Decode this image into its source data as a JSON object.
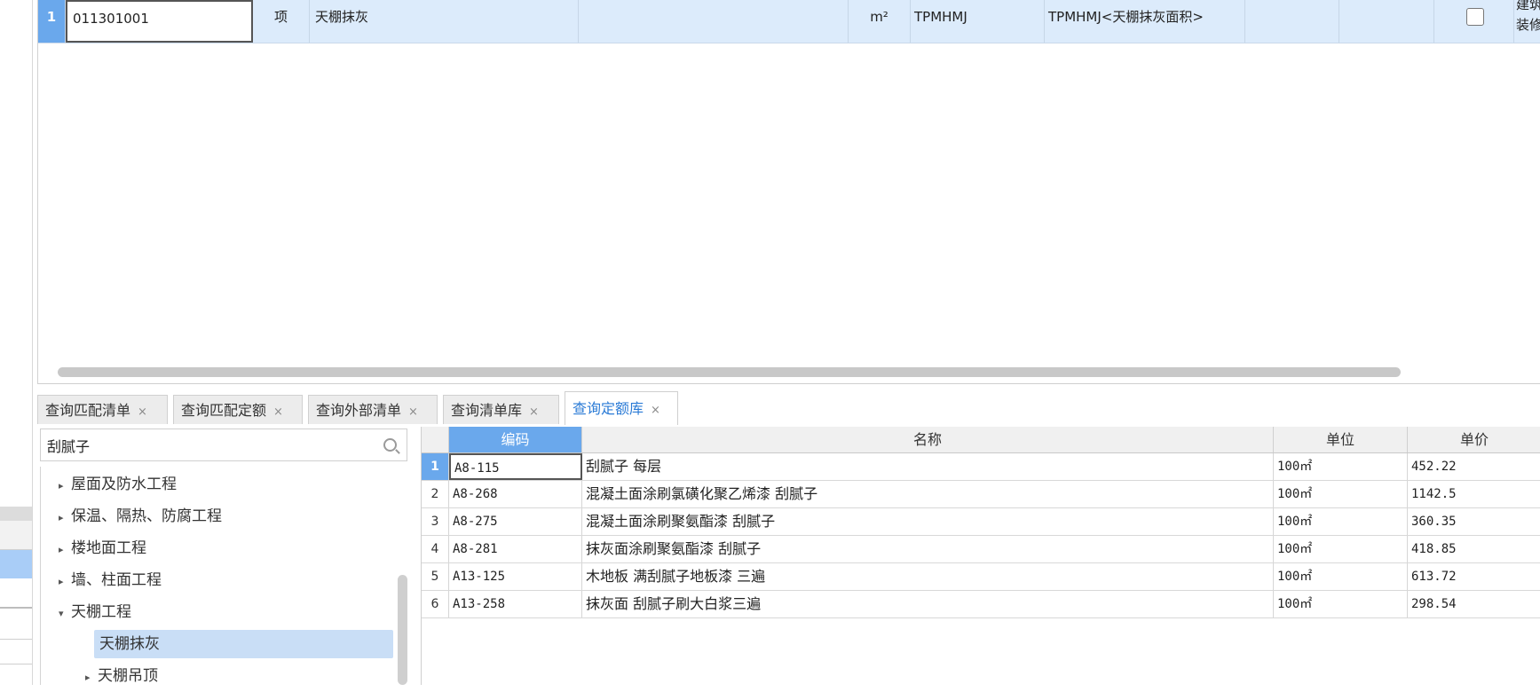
{
  "top_row": {
    "row_number": "1",
    "code": "011301001",
    "type": "项",
    "name": "天棚抹灰",
    "feature": "",
    "unit": "m²",
    "expression": "TPMHMJ",
    "expression_desc": "TPMHMJ<天棚抹灰面积>",
    "empty1": "",
    "empty2": "",
    "category_line1": "建筑装饰",
    "category_line2": "装修工程"
  },
  "tabs": [
    {
      "label": "查询匹配清单",
      "active": false
    },
    {
      "label": "查询匹配定额",
      "active": false
    },
    {
      "label": "查询外部清单",
      "active": false
    },
    {
      "label": "查询清单库",
      "active": false
    },
    {
      "label": "查询定额库",
      "active": true
    }
  ],
  "tab_close_glyph": "×",
  "search": {
    "value": "刮腻子"
  },
  "tree": {
    "items": [
      {
        "label": "屋面及防水工程",
        "arrow": "▸"
      },
      {
        "label": "保温、隔热、防腐工程",
        "arrow": "▸"
      },
      {
        "label": "楼地面工程",
        "arrow": "▸"
      },
      {
        "label": "墙、柱面工程",
        "arrow": "▸"
      },
      {
        "label": "天棚工程",
        "arrow": "▾"
      },
      {
        "label": "天棚抹灰",
        "arrow": ""
      },
      {
        "label": "天棚吊顶",
        "arrow": "▸"
      }
    ]
  },
  "quota_table": {
    "headers": {
      "code": "编码",
      "name": "名称",
      "unit": "单位",
      "price": "单价"
    },
    "rows": [
      {
        "num": "1",
        "code": "A8-115",
        "name": "刮腻子 每层",
        "unit": "100㎡",
        "price": "452.22"
      },
      {
        "num": "2",
        "code": "A8-268",
        "name": "混凝土面涂刷氯磺化聚乙烯漆 刮腻子",
        "unit": "100㎡",
        "price": "1142.5"
      },
      {
        "num": "3",
        "code": "A8-275",
        "name": "混凝土面涂刷聚氨酯漆 刮腻子",
        "unit": "100㎡",
        "price": "360.35"
      },
      {
        "num": "4",
        "code": "A8-281",
        "name": "抹灰面涂刷聚氨酯漆 刮腻子",
        "unit": "100㎡",
        "price": "418.85"
      },
      {
        "num": "5",
        "code": "A13-125",
        "name": "木地板 满刮腻子地板漆 三遍",
        "unit": "100㎡",
        "price": "613.72"
      },
      {
        "num": "6",
        "code": "A13-258",
        "name": "抹灰面 刮腻子刷大白浆三遍",
        "unit": "100㎡",
        "price": "298.54"
      }
    ]
  }
}
